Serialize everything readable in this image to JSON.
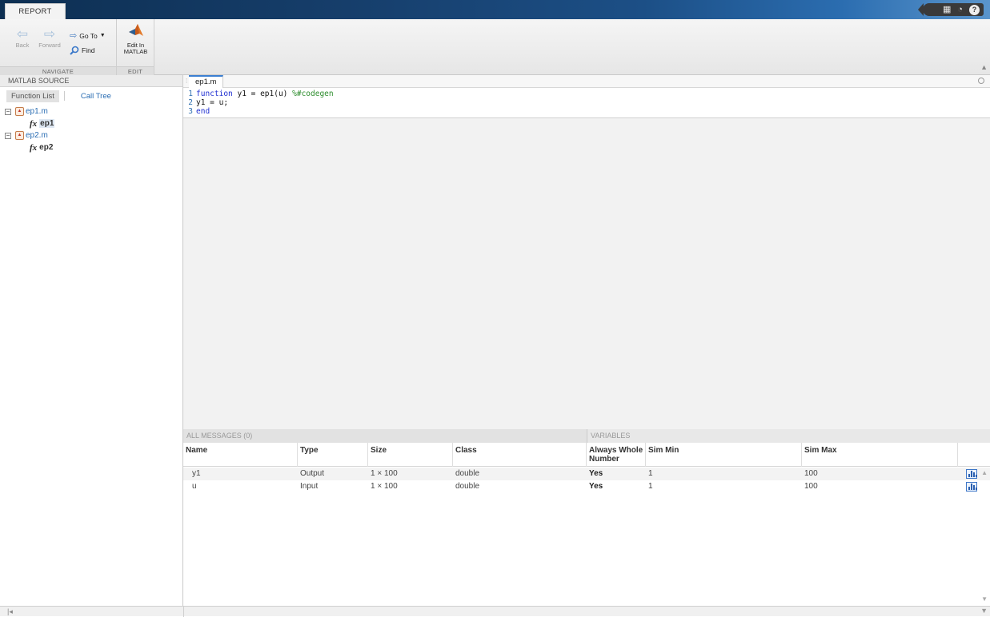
{
  "titlebar": {
    "tab": "REPORT"
  },
  "toolstrip": {
    "back": "Back",
    "forward": "Forward",
    "goto": "Go To",
    "find": "Find",
    "edit_line1": "Edit In",
    "edit_line2": "MATLAB",
    "section_nav": "NAVIGATE",
    "section_edit": "EDIT"
  },
  "left": {
    "header": "MATLAB SOURCE",
    "tab_function_list": "Function List",
    "tab_call_tree": "Call Tree",
    "files": [
      {
        "name": "ep1.m",
        "function": "ep1"
      },
      {
        "name": "ep2.m",
        "function": "ep2"
      }
    ],
    "toggle": "−"
  },
  "editor": {
    "tab": "ep1.m",
    "lines": [
      {
        "num": "1",
        "kw": "function",
        "text": " y1 = ep1(u) ",
        "comment": "%#codegen"
      },
      {
        "num": "2",
        "kw": "",
        "text": "y1 = u;",
        "comment": ""
      },
      {
        "num": "3",
        "kw": "end",
        "text": "",
        "comment": ""
      }
    ]
  },
  "bottom": {
    "messages_header": "ALL MESSAGES (0)",
    "variables_header": "VARIABLES",
    "columns": {
      "name": "Name",
      "type": "Type",
      "size": "Size",
      "class": "Class",
      "always_whole_1": "Always Whole",
      "always_whole_2": "Number",
      "sim_min": "Sim Min",
      "sim_max": "Sim Max"
    },
    "rows": [
      {
        "name": "y1",
        "type": "Output",
        "size": "1 × 100",
        "class": "double",
        "whole": "Yes",
        "min": "1",
        "max": "100"
      },
      {
        "name": "u",
        "type": "Input",
        "size": "1 × 100",
        "class": "double",
        "whole": "Yes",
        "min": "1",
        "max": "100"
      }
    ]
  },
  "icons": {
    "back": "left-arrow-icon",
    "forward": "right-arrow-icon",
    "goto": "goto-icon",
    "find": "magnifier-icon",
    "edit": "matlab-logo-icon",
    "histogram": "histogram-icon"
  },
  "colors": {
    "link": "#2a6db3",
    "keyword": "#1f2fd1",
    "comment": "#2c8c2c",
    "titlebar": "#163e6b"
  }
}
